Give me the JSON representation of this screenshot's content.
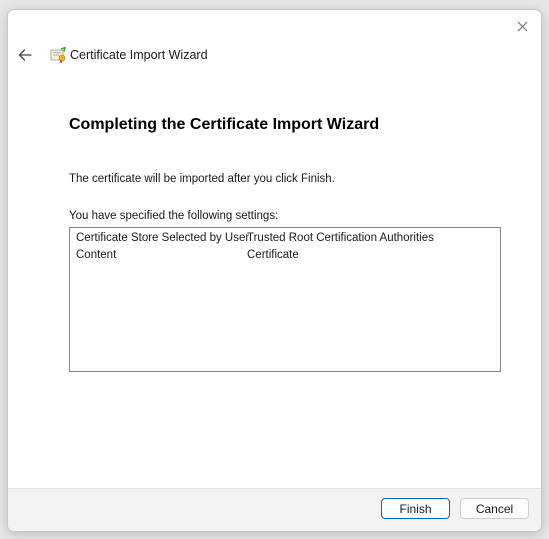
{
  "window": {
    "title": "Certificate Import Wizard"
  },
  "icons": {
    "close": "close-icon",
    "back": "back-arrow-icon",
    "app": "certificate-icon"
  },
  "main": {
    "heading": "Completing the Certificate Import Wizard",
    "description": "The certificate will be imported after you click Finish.",
    "settings_label": "You have specified the following settings:",
    "settings": [
      {
        "key": "Certificate Store Selected by User",
        "value": "Trusted Root Certification Authorities"
      },
      {
        "key": "Content",
        "value": "Certificate"
      }
    ]
  },
  "footer": {
    "finish_label": "Finish",
    "cancel_label": "Cancel"
  },
  "colors": {
    "accent": "#0067c0",
    "footer_bg": "#f3f3f3"
  }
}
